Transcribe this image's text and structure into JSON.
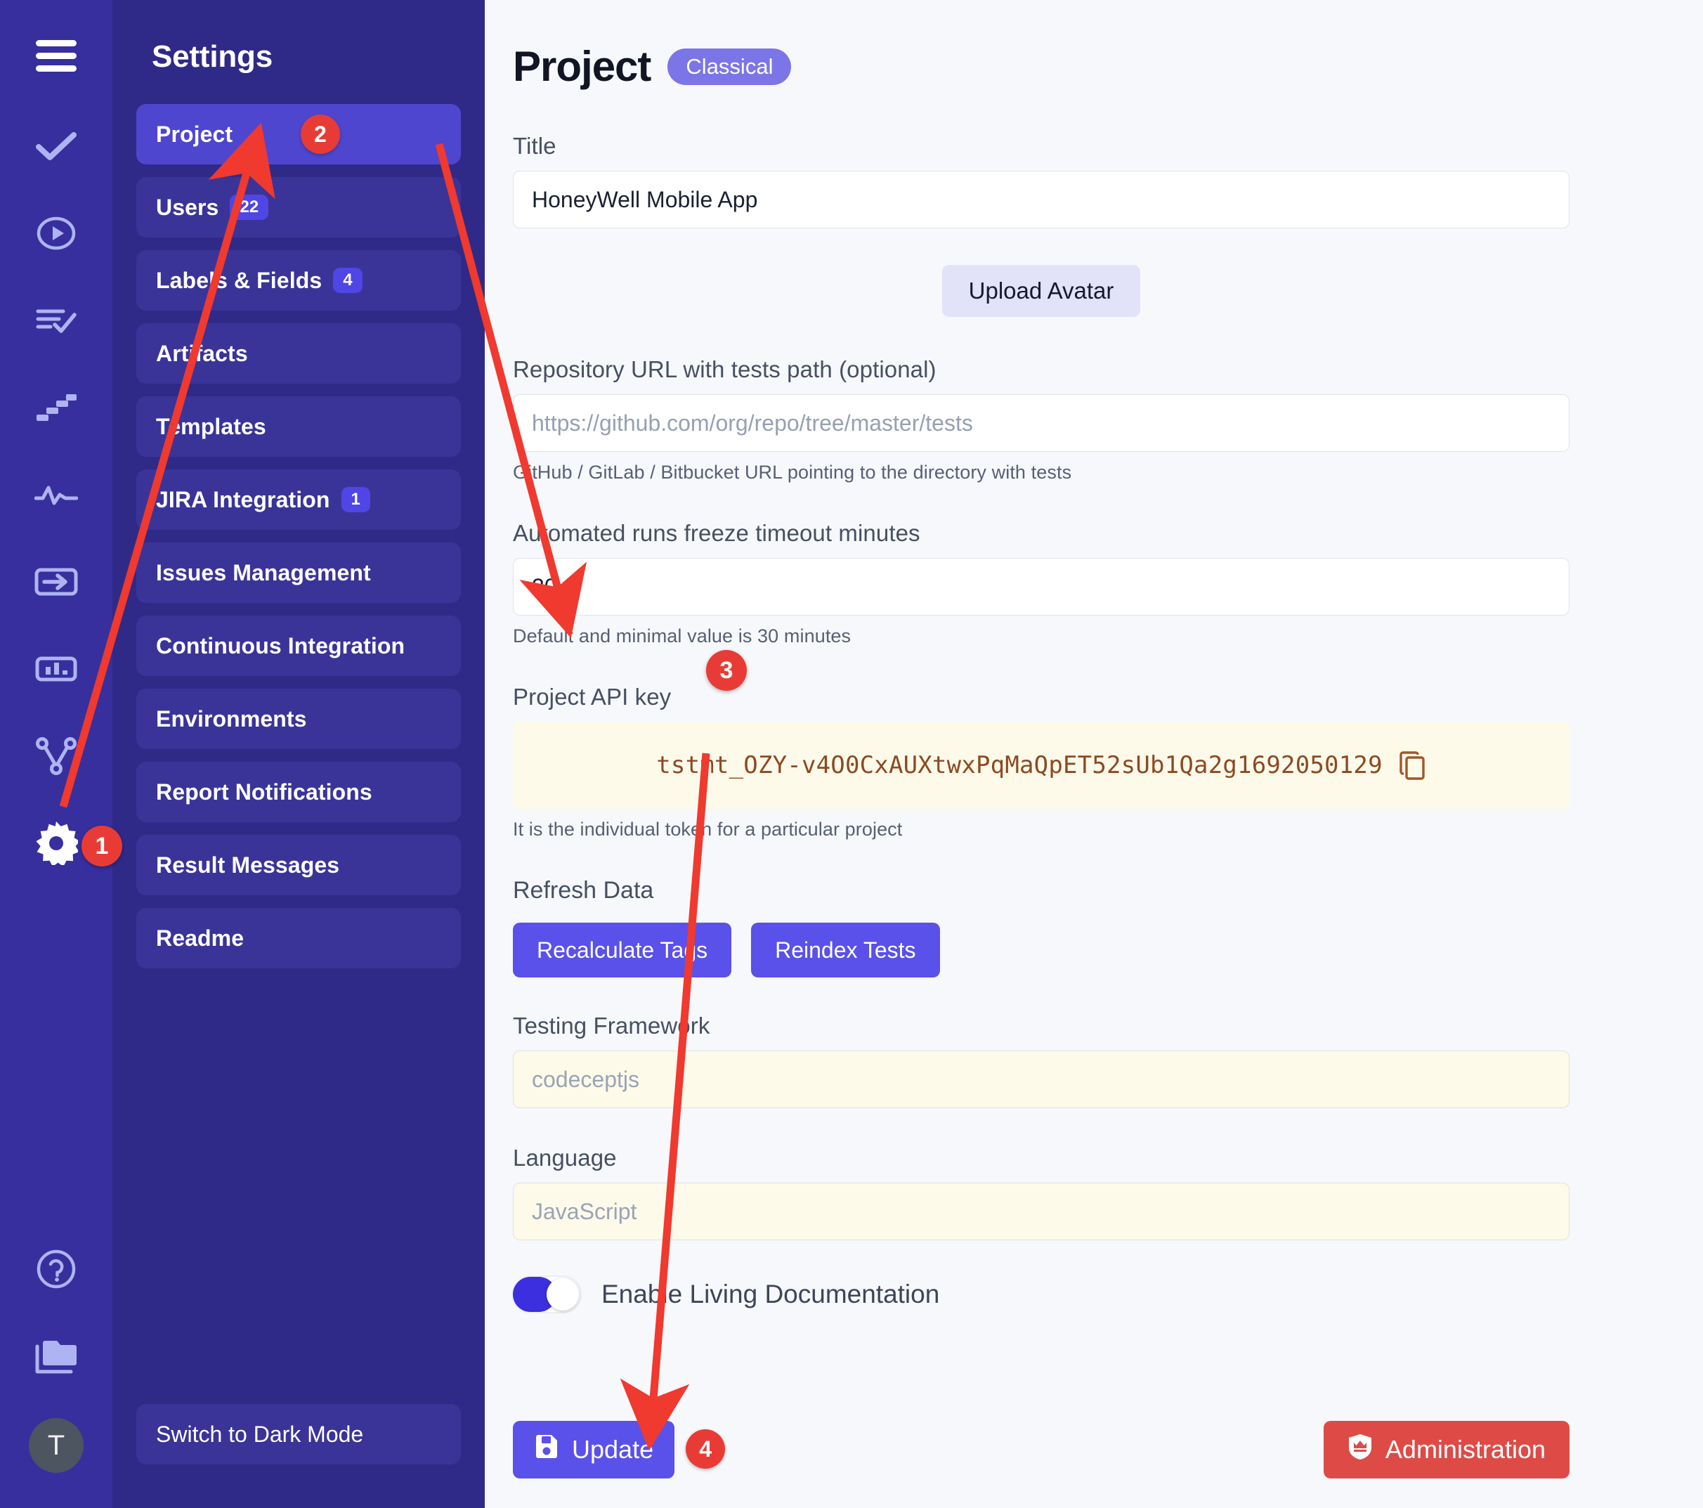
{
  "rail": {
    "icons": [
      {
        "name": "menu-hamburger-icon",
        "label": "Menu"
      },
      {
        "name": "check-tests-icon",
        "label": "Tests"
      },
      {
        "name": "play-circle-runs-icon",
        "label": "Runs"
      },
      {
        "name": "list-check-plans-icon",
        "label": "Plans"
      },
      {
        "name": "stairs-steps-icon",
        "label": "Steps"
      },
      {
        "name": "activity-pulse-icon",
        "label": "Activity"
      },
      {
        "name": "import-arrow-icon",
        "label": "Import"
      },
      {
        "name": "bar-chart-analytics-icon",
        "label": "Analytics"
      },
      {
        "name": "branch-network-icon",
        "label": "Branches"
      },
      {
        "name": "gear-settings-icon",
        "label": "Settings"
      }
    ],
    "bottom_icons": [
      {
        "name": "help-circle-icon",
        "label": "Help"
      },
      {
        "name": "folder-projects-icon",
        "label": "Projects"
      }
    ],
    "avatar_initial": "T"
  },
  "sidebar": {
    "title": "Settings",
    "items": [
      {
        "label": "Project",
        "badge": null,
        "active": true
      },
      {
        "label": "Users",
        "badge": "22",
        "active": false
      },
      {
        "label": "Labels & Fields",
        "badge": "4",
        "active": false
      },
      {
        "label": "Artifacts",
        "badge": null,
        "active": false
      },
      {
        "label": "Templates",
        "badge": null,
        "active": false
      },
      {
        "label": "JIRA Integration",
        "badge": "1",
        "active": false
      },
      {
        "label": "Issues Management",
        "badge": null,
        "active": false
      },
      {
        "label": "Continuous Integration",
        "badge": null,
        "active": false
      },
      {
        "label": "Environments",
        "badge": null,
        "active": false
      },
      {
        "label": "Report Notifications",
        "badge": null,
        "active": false
      },
      {
        "label": "Result Messages",
        "badge": null,
        "active": false
      },
      {
        "label": "Readme",
        "badge": null,
        "active": false
      }
    ],
    "dark_mode_label": "Switch to Dark Mode"
  },
  "main": {
    "page_title": "Project",
    "page_badge": "Classical",
    "title_field": {
      "label": "Title",
      "value": "HoneyWell Mobile App"
    },
    "upload_avatar_label": "Upload Avatar",
    "repo_field": {
      "label": "Repository URL with tests path (optional)",
      "placeholder": "https://github.com/org/repo/tree/master/tests",
      "hint": "GitHub / GitLab / Bitbucket URL pointing to the directory with tests"
    },
    "freeze_field": {
      "label": "Automated runs freeze timeout minutes",
      "value": "30",
      "hint": "Default and minimal value is 30 minutes"
    },
    "api_key_field": {
      "label": "Project API key",
      "value": "tstmt_OZY-v4O0CxAUXtwxPqMaQpET52sUb1Qa2g1692050129",
      "hint": "It is the individual token for a particular project"
    },
    "refresh_section": {
      "label": "Refresh Data",
      "recalculate_label": "Recalculate Tags",
      "reindex_label": "Reindex Tests"
    },
    "framework_field": {
      "label": "Testing Framework",
      "placeholder": "codeceptjs"
    },
    "language_field": {
      "label": "Language",
      "placeholder": "JavaScript"
    },
    "living_doc": {
      "label": "Enable Living Documentation",
      "enabled": true
    },
    "update_label": "Update",
    "administration_label": "Administration"
  },
  "annotations": {
    "steps": [
      {
        "n": "1",
        "target": "gear-settings-icon"
      },
      {
        "n": "2",
        "target": "sidebar-item-project"
      },
      {
        "n": "3",
        "target": "freeze-timeout-input"
      },
      {
        "n": "4",
        "target": "update-button"
      }
    ],
    "arrow_color": "#f0392f"
  },
  "colors": {
    "rail_bg": "#372f9e",
    "sidebar_bg": "#2f2a87",
    "nav_item_bg": "#3a3499",
    "nav_active_bg": "#4f46cf",
    "accent": "#5a51ea",
    "danger": "#de4b47",
    "main_bg": "#f7f8fc",
    "annotation_red": "#e93b35",
    "api_key_bg": "#fdfaea",
    "api_key_text": "#8c4a22"
  }
}
